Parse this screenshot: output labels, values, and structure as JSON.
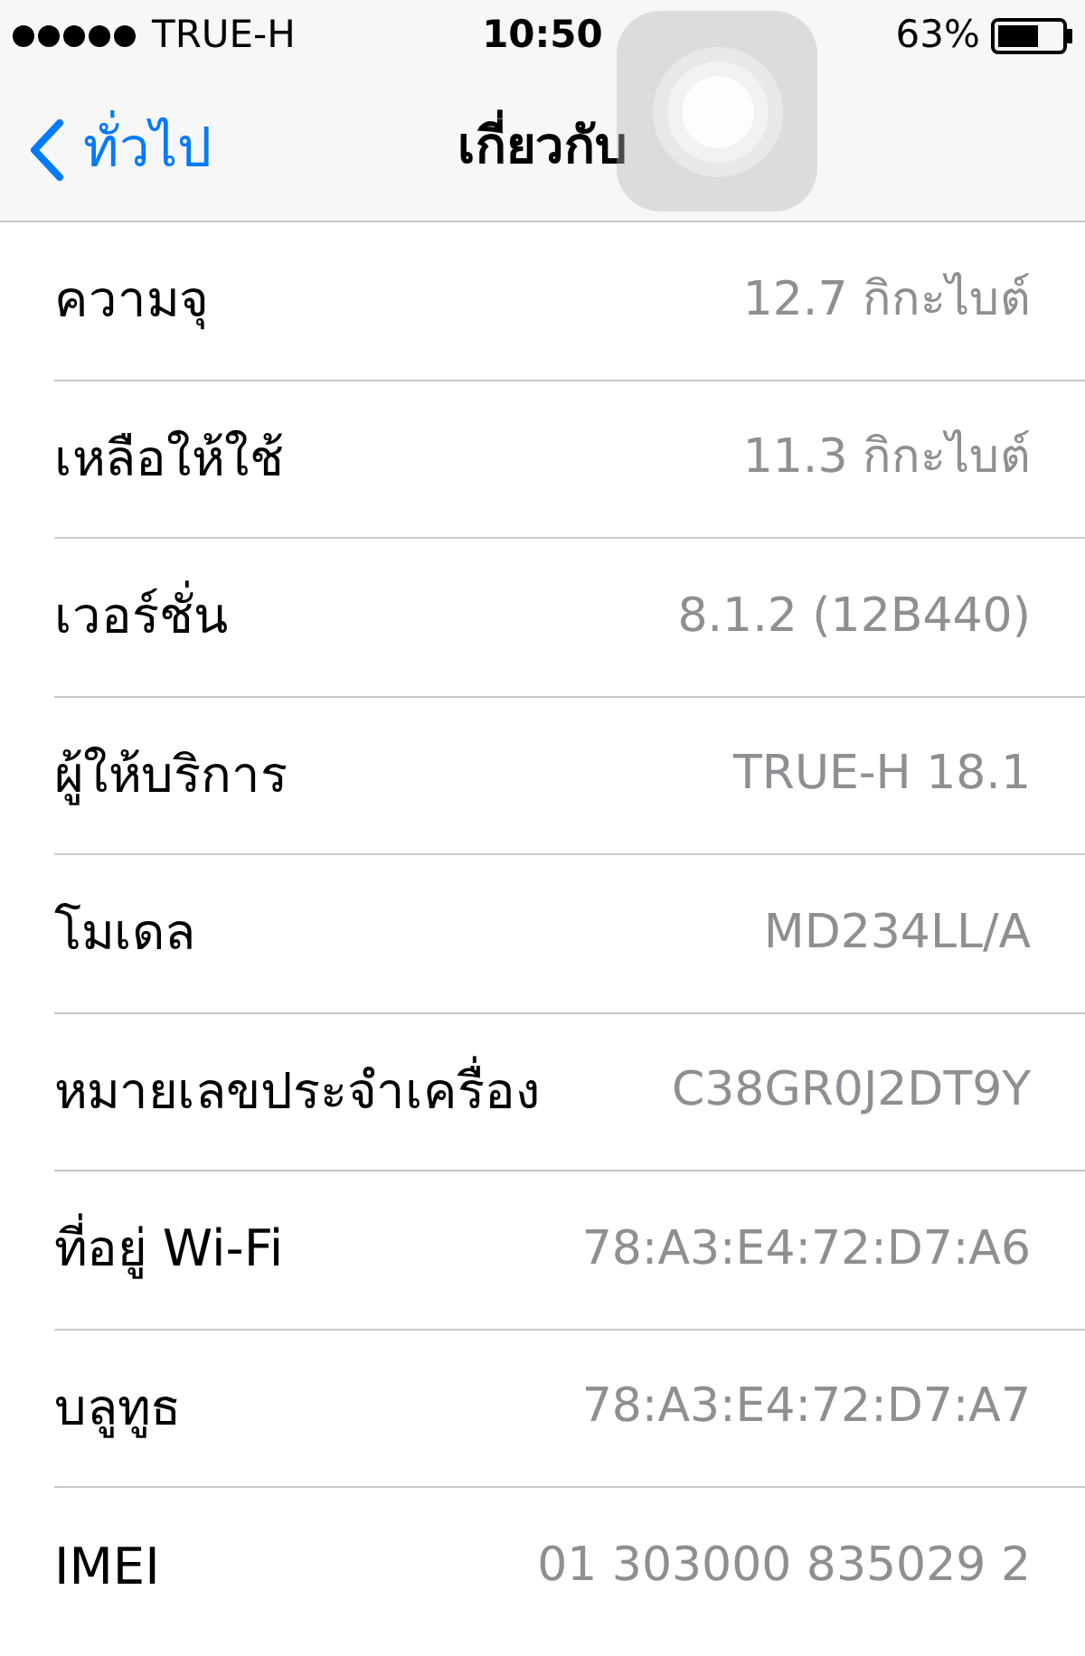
{
  "status_bar": {
    "carrier": "TRUE-H",
    "time": "10:50",
    "battery": "63%"
  },
  "nav": {
    "back": "ทั่วไป",
    "title": "เกี่ยวกับ"
  },
  "rows": [
    {
      "label": "ความจุ",
      "value": "12.7 กิกะไบต์"
    },
    {
      "label": "เหลือให้ใช้",
      "value": "11.3 กิกะไบต์"
    },
    {
      "label": "เวอร์ชั่น",
      "value": "8.1.2 (12B440)"
    },
    {
      "label": "ผู้ให้บริการ",
      "value": "TRUE-H 18.1"
    },
    {
      "label": "โมเดล",
      "value": "MD234LL/A"
    },
    {
      "label": "หมายเลขประจำเครื่อง",
      "value": "C38GR0J2DT9Y"
    },
    {
      "label": "ที่อยู่ Wi-Fi",
      "value": "78:A3:E4:72:D7:A6"
    },
    {
      "label": "บลูทูธ",
      "value": "78:A3:E4:72:D7:A7"
    },
    {
      "label": "IMEI",
      "value": "01 303000 835029 2"
    }
  ]
}
